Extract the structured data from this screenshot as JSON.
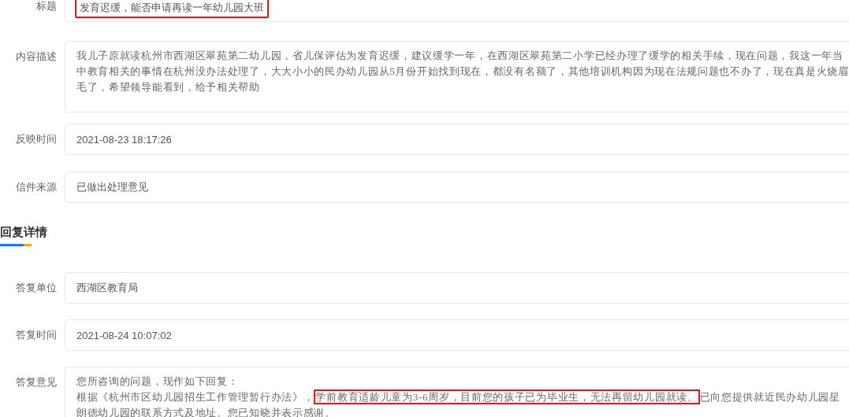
{
  "fields": [
    {
      "label": "标题",
      "kind": "title",
      "value": "发育迟缓，能否申请再读一年幼儿园大班",
      "highlighted": true
    },
    {
      "label": "内容描述",
      "kind": "textarea",
      "value": "我儿子原就读杭州市西湖区翠苑第二幼儿园，省儿保评估为发育迟缓，建议缓学一年，在西湖区翠苑第二小学已经办理了缓学的相关手续，现在问题，我这一年当中教育相关的事情在杭州没办法处理了，大大小小的民办幼儿园从5月份开始找到现在，都没有名额了，其他培训机构因为现在法规问题也不办了，现在真是火烧眉毛了，希望领导能看到，给予相关帮助"
    },
    {
      "label": "反映时间",
      "kind": "text",
      "value": "2021-08-23 18:17:26"
    },
    {
      "label": "信件来源",
      "kind": "text",
      "value": "已做出处理意见"
    }
  ],
  "reply_section": {
    "title": "回复详情",
    "fields": [
      {
        "label": "答复单位",
        "kind": "text",
        "value": "西湖区教育局"
      },
      {
        "label": "答复时间",
        "kind": "text",
        "value": "2021-08-24 10:07:02"
      },
      {
        "label": "答复意见",
        "kind": "segments",
        "segments": [
          {
            "text": "您所咨询的问题，现作如下回复：",
            "kind": "line",
            "highlighted": false
          },
          {
            "text": "根据《杭州市区幼儿园招生工作管理暂行办法》，",
            "kind": "inline",
            "highlighted": false
          },
          {
            "text": "学前教育适龄儿童为3-6周岁，目前您的孩子已为毕业生，无法再留幼儿园就读。",
            "kind": "inline",
            "highlighted": true
          },
          {
            "text": "已向您提供就近民办幼儿园星朗德幼儿园的联系方式及地址。您已知晓并表示感谢。",
            "kind": "inline",
            "highlighted": false
          }
        ]
      }
    ]
  }
}
